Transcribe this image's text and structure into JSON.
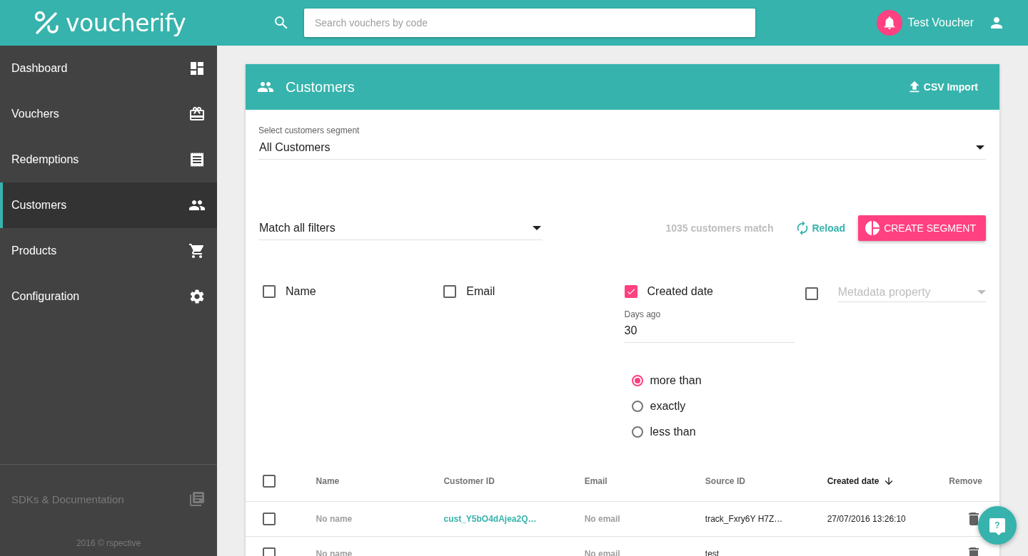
{
  "header": {
    "logo": "voucherify",
    "search": {
      "placeholder": "Search vouchers by code"
    },
    "user": {
      "name": "Test Voucher"
    }
  },
  "sidebar": {
    "items": [
      {
        "label": "Dashboard",
        "selected": false
      },
      {
        "label": "Vouchers",
        "selected": false
      },
      {
        "label": "Redemptions",
        "selected": false
      },
      {
        "label": "Customers",
        "selected": true
      },
      {
        "label": "Products",
        "selected": false
      },
      {
        "label": "Configuration",
        "selected": false
      }
    ],
    "footer": {
      "link": "SDKs & Documentation",
      "copyright": "2016 © rspective"
    }
  },
  "panel": {
    "title": "Customers",
    "import_button": "CSV Import",
    "segment": {
      "label": "Select customers segment",
      "value": "All Customers"
    },
    "match": {
      "value": "Match all filters"
    },
    "count": "1035 customers match",
    "reload": "Reload",
    "create_button": "CREATE SEGMENT",
    "filters": [
      {
        "kind": "checkbox",
        "label": "Name",
        "checked": false
      },
      {
        "kind": "checkbox",
        "label": "Email",
        "checked": false
      },
      {
        "kind": "checkbox",
        "label": "Created date",
        "checked": true
      },
      {
        "kind": "select",
        "placeholder": "Metadata property",
        "checked": false
      }
    ],
    "days": {
      "label": "Days ago",
      "value": "30"
    },
    "comparison": [
      {
        "label": "more than",
        "selected": true
      },
      {
        "label": "exactly",
        "selected": false
      },
      {
        "label": "less than",
        "selected": false
      }
    ]
  },
  "table": {
    "all_checked": false,
    "columns": [
      {
        "label": "Name",
        "sorted": false
      },
      {
        "label": "Customer ID",
        "sorted": false
      },
      {
        "label": "Email",
        "sorted": false
      },
      {
        "label": "Source ID",
        "sorted": false
      },
      {
        "label": "Created date",
        "sorted": true
      },
      {
        "label": "Remove",
        "sorted": false
      }
    ],
    "rows": [
      {
        "checked": false,
        "name": "No name",
        "customer_id": "cust_Y5bO4dAjea2Q…",
        "email": "No email",
        "source_id": "track_Fxry6Y H7Z…",
        "created": "27/07/2016 13:26:10"
      },
      {
        "checked": false,
        "name": "No name",
        "email": "No email",
        "source_id": "test"
      }
    ]
  },
  "help_button": "?"
}
